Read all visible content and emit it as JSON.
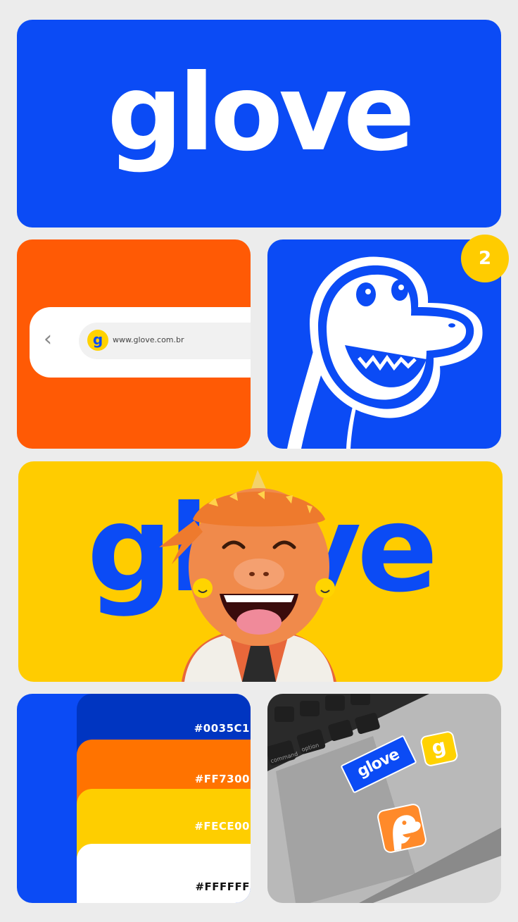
{
  "colors": {
    "brand_blue": "#0b4bf5",
    "orange": "#ff5a05",
    "yellow": "#ffcc00",
    "white": "#ffffff",
    "dark": "#1f1f1f"
  },
  "logo_card": {
    "logo_text": "glove"
  },
  "browser_card": {
    "back_icon": "chevron-left-icon",
    "favicon_letter": "g",
    "url": "www.glove.com.br"
  },
  "mascot_card": {
    "badge_number": "2",
    "mascot_icon": "dinosaur-mascot-icon"
  },
  "hero_card": {
    "logo_text": "glove",
    "mascot_icon": "dinosaur-3d-mascot-icon"
  },
  "palette_card": {
    "swatches": [
      {
        "hex": "#0035C1",
        "color": "#0035c1",
        "text_color": "#ffffff"
      },
      {
        "hex": "#FF7300",
        "color": "#ff7300",
        "text_color": "#ffffff"
      },
      {
        "hex": "#FECE00",
        "color": "#fece00",
        "text_color": "#ffffff"
      },
      {
        "hex": "#FFFFFF",
        "color": "#ffffff",
        "text_color": "#111111"
      }
    ]
  },
  "laptop_card": {
    "key_labels": {
      "command": "command",
      "option": "option"
    },
    "sticker_logo_text": "glove",
    "sticker_letter": "g"
  }
}
